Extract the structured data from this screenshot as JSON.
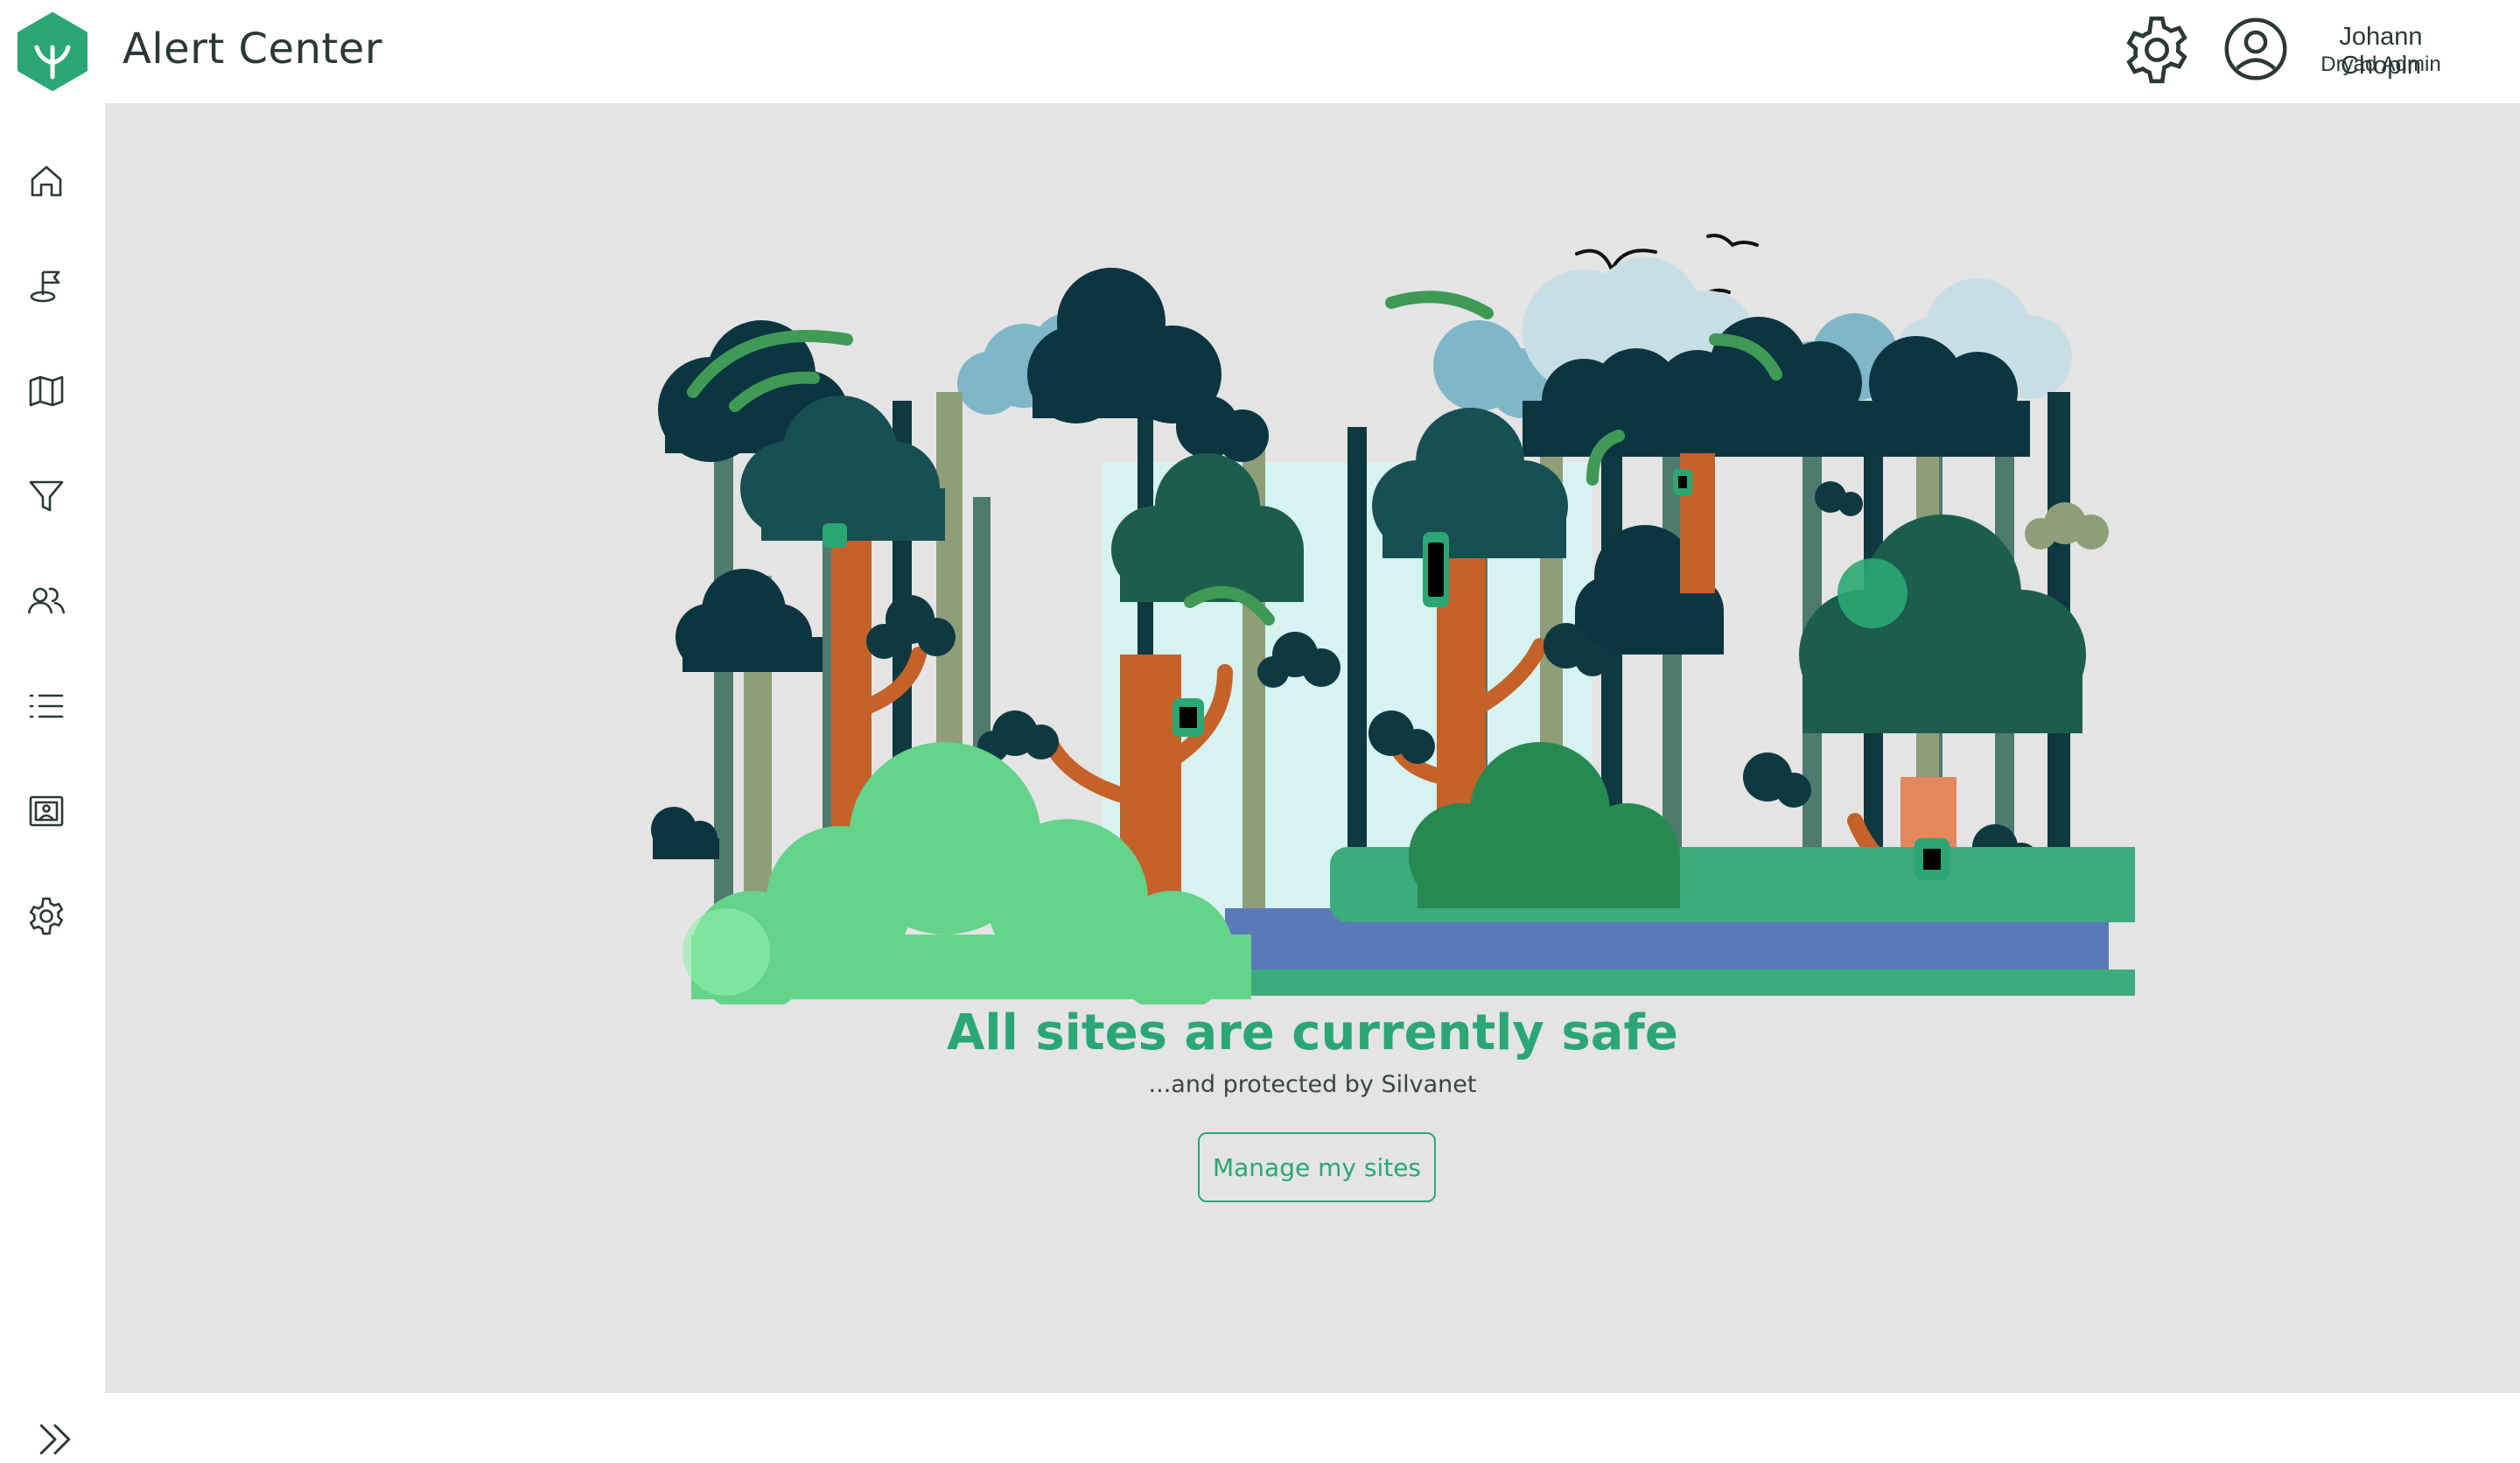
{
  "app": {
    "title": "Alert Center",
    "brand_color": "#2aa774",
    "logo_icon": "leaf-hexagon-icon"
  },
  "header": {
    "settings_icon": "gear-icon",
    "user": {
      "avatar_icon": "user-circle-icon",
      "name": "Johann Chopin",
      "role": "Dryad Admin"
    }
  },
  "sidebar": {
    "items": [
      {
        "id": "home",
        "icon": "home-icon"
      },
      {
        "id": "sites",
        "icon": "flag-icon"
      },
      {
        "id": "map",
        "icon": "map-icon"
      },
      {
        "id": "filter",
        "icon": "filter-icon"
      },
      {
        "id": "users",
        "icon": "users-icon"
      },
      {
        "id": "list",
        "icon": "list-icon"
      },
      {
        "id": "gallery",
        "icon": "gallery-icon"
      },
      {
        "id": "settings",
        "icon": "gear-icon"
      }
    ],
    "expand_icon": "chevrons-right-icon"
  },
  "main": {
    "illustration": "forest-with-sensors",
    "headline": "All sites are currently safe",
    "subline": "...and protected by Silvanet",
    "cta_label": "Manage my sites",
    "background_color": "#e4e4e4"
  }
}
